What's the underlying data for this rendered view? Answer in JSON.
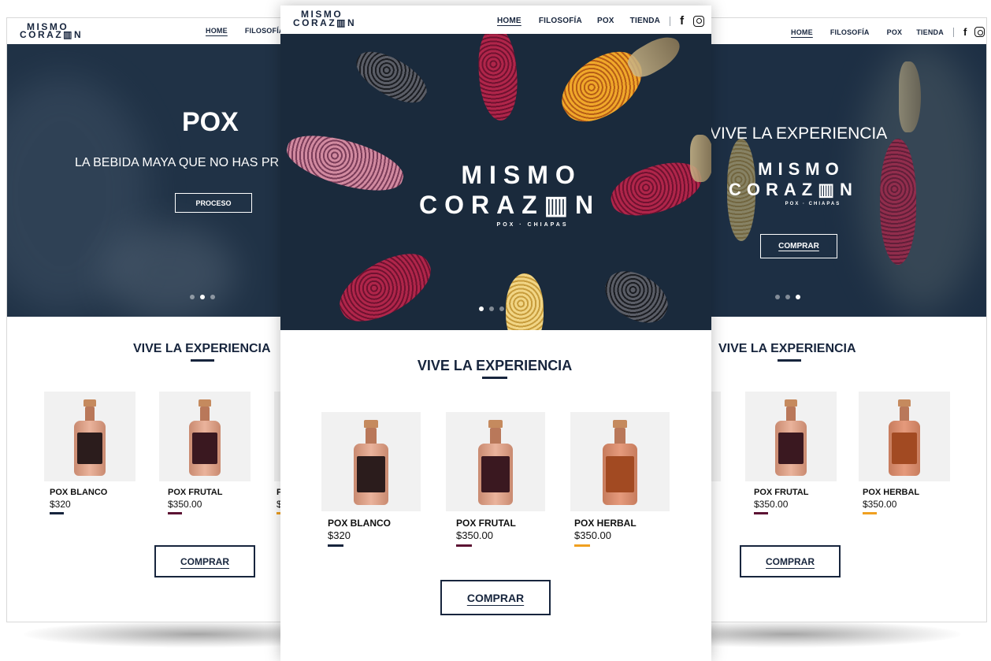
{
  "brand": {
    "line1": "MISMO",
    "line2": "CORAZ▥N",
    "tagline": "POX · CHIAPAS"
  },
  "nav": {
    "home": "HOME",
    "filosofia": "FILOSOFÍA",
    "pox": "POX",
    "tienda": "TIENDA",
    "facebook": "f"
  },
  "left": {
    "hero_title": "POX",
    "hero_subtitle": "LA BEBIDA MAYA QUE NO HAS PR",
    "hero_button": "PROCESO",
    "section_title": "VIVE LA EXPERIENCIA",
    "products": [
      {
        "name": "POX BLANCO",
        "price": "$320",
        "bar_color": "#17253d"
      },
      {
        "name": "POX FRUTAL",
        "price": "$350.00",
        "bar_color": "#5c1333"
      },
      {
        "name": "P",
        "price": "$",
        "bar_color": "#f0a020"
      }
    ],
    "cta": "COMPRAR",
    "carousel_active": 2
  },
  "center": {
    "section_title": "VIVE LA EXPERIENCIA",
    "products": [
      {
        "name": "POX BLANCO",
        "price": "$320",
        "bar_color": "#17253d"
      },
      {
        "name": "POX FRUTAL",
        "price": "$350.00",
        "bar_color": "#5c1333"
      },
      {
        "name": "POX HERBAL",
        "price": "$350.00",
        "bar_color": "#f0a020"
      }
    ],
    "cta": "COMPRAR",
    "carousel_active": 1
  },
  "right": {
    "hero_title": "VIVE LA EXPERIENCIA",
    "hero_button": "COMPRAR",
    "section_title": "VIVE LA EXPERIENCIA",
    "products": [
      {
        "name": "POX FRUTAL",
        "price": "$350.00",
        "bar_color": "#5c1333"
      },
      {
        "name": "POX HERBAL",
        "price": "$350.00",
        "bar_color": "#f0a020"
      }
    ],
    "cta": "COMPRAR",
    "carousel_active": 3
  },
  "colors": {
    "navy": "#17253d",
    "hero_bg": "#1b2c3f",
    "maroon": "#5c1333",
    "amber": "#f0a020"
  }
}
